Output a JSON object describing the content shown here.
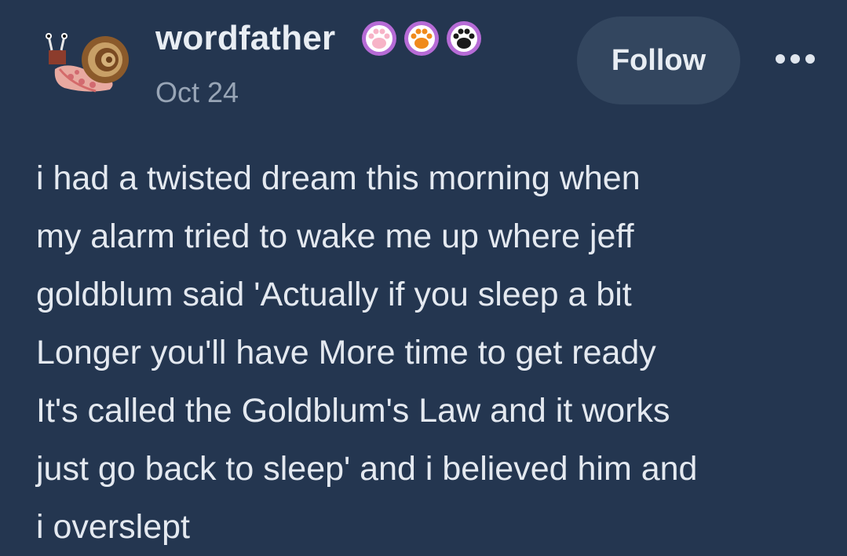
{
  "post": {
    "author": {
      "username": "wordfather",
      "avatar_icon": "snail-avatar-icon",
      "badges": [
        {
          "icon": "paw-badge-icon",
          "paw_color": "#f7b3c7",
          "ring_color": "#b66bd6"
        },
        {
          "icon": "paw-badge-icon",
          "paw_color": "#f08a1c",
          "ring_color": "#b66bd6"
        },
        {
          "icon": "paw-badge-icon",
          "paw_color": "#1a1a1a",
          "ring_color": "#b66bd6"
        }
      ]
    },
    "date": "Oct 24",
    "follow_label": "Follow",
    "more_icon": "more-options-icon",
    "body_lines": [
      "i had a twisted dream this morning when",
      "my alarm tried to wake me up where jeff",
      "goldblum said 'Actually if you sleep a bit",
      "Longer you'll have More time to get ready",
      "It's called the Goldblum's Law and it works",
      "just go back to sleep' and i believed him and",
      "i overslept"
    ]
  },
  "colors": {
    "background": "#243650",
    "follow_button": "#33465f",
    "text": "#e4e9f0",
    "muted_text": "#98a5b6"
  }
}
